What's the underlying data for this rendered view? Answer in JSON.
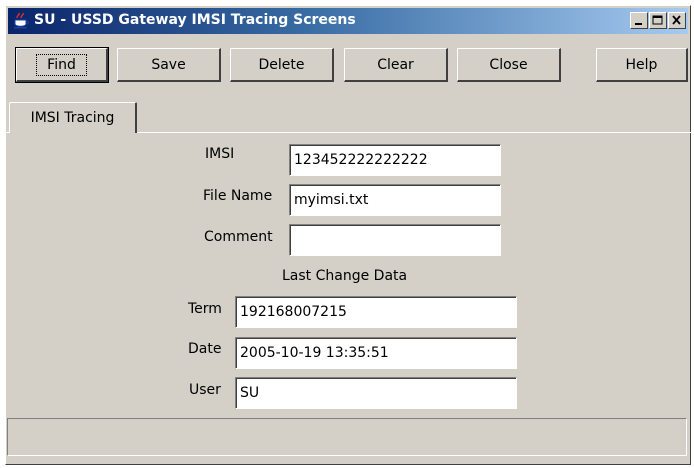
{
  "window": {
    "title": "SU - USSD Gateway IMSI Tracing Screens"
  },
  "titlebar_buttons": {
    "minimize_icon": "minimize-icon",
    "maximize_icon": "maximize-icon",
    "close_icon": "close-icon"
  },
  "toolbar": {
    "find": "Find",
    "save": "Save",
    "delete": "Delete",
    "clear": "Clear",
    "close": "Close",
    "help": "Help"
  },
  "tabs": [
    {
      "label": "IMSI Tracing",
      "active": true
    }
  ],
  "form": {
    "imsi_label": "IMSI",
    "imsi_value": "123452222222222",
    "file_name_label": "File Name",
    "file_name_value": "myimsi.txt",
    "comment_label": "Comment",
    "comment_value": "",
    "last_change_heading": "Last Change Data",
    "term_label": "Term",
    "term_value": "192168007215",
    "date_label": "Date",
    "date_value": "2005-10-19 13:35:51",
    "user_label": "User",
    "user_value": "SU"
  },
  "status": {
    "text": ""
  },
  "colors": {
    "titlebar_start": "#0a246a",
    "titlebar_end": "#a6caf0",
    "face": "#d4d0c8"
  }
}
